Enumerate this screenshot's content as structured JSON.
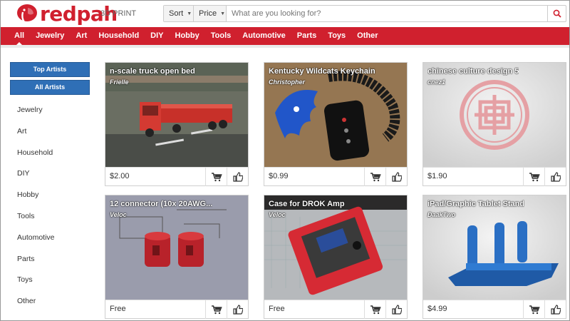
{
  "header": {
    "brand": "redpah",
    "brand_sub": "3D PRINT",
    "sort_label": "Sort",
    "price_label": "Price",
    "search_placeholder": "What are you looking for?"
  },
  "nav": {
    "items": [
      "All",
      "Jewelry",
      "Art",
      "Household",
      "DIY",
      "Hobby",
      "Tools",
      "Automotive",
      "Parts",
      "Toys",
      "Other"
    ],
    "active": "All"
  },
  "sidebar": {
    "buttons": [
      "Top Artists",
      "All Artists"
    ],
    "categories": [
      "Jewelry",
      "Art",
      "Household",
      "DIY",
      "Hobby",
      "Tools",
      "Automotive",
      "Parts",
      "Toys",
      "Other"
    ]
  },
  "products": [
    {
      "title": "n-scale truck open bed",
      "author": "Frielle",
      "price": "$2.00"
    },
    {
      "title": "Kentucky Wildcats Keychain",
      "author": "Christopher",
      "price": "$0.99"
    },
    {
      "title": "chinese culture design 5",
      "author": "cnez1",
      "price": "$1.90"
    },
    {
      "title": "12 connector (10x 20AWG...",
      "author": "Veloc",
      "price": "Free"
    },
    {
      "title": "Case for DROK Amp",
      "author": "Veloc",
      "price": "Free"
    },
    {
      "title": "iPad/Graphic Tablet Stand",
      "author": "DaakTwo",
      "price": "$4.99"
    }
  ],
  "colors": {
    "brand": "#d0202e",
    "button_blue": "#2f6fb6"
  }
}
